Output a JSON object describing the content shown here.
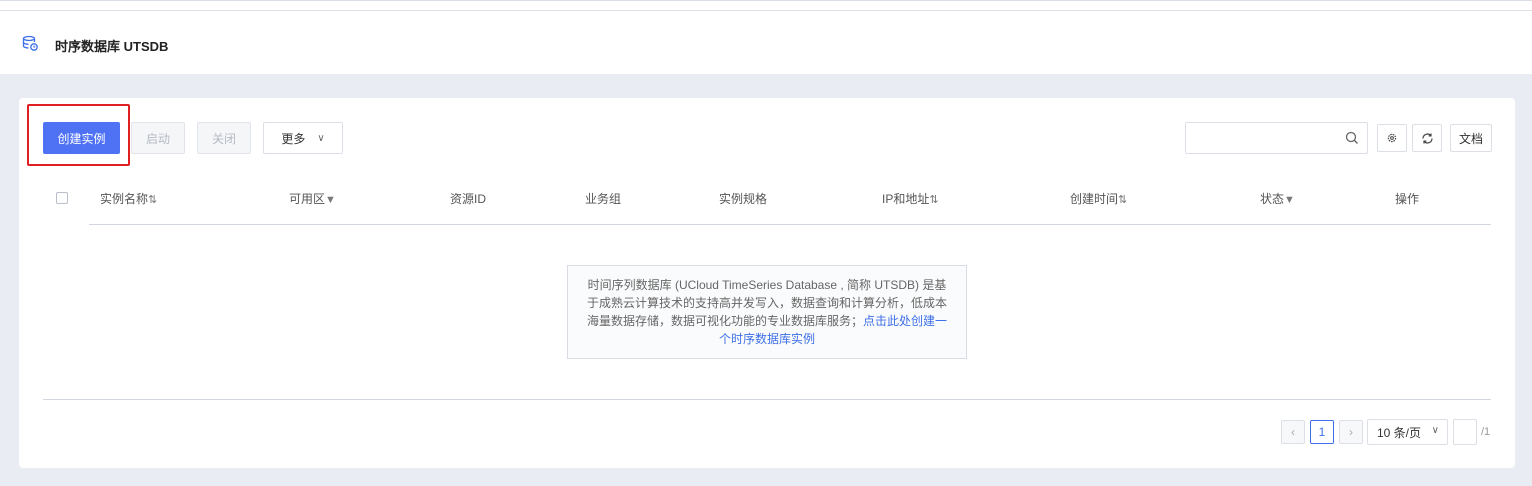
{
  "header": {
    "title": "时序数据库 UTSDB",
    "icon": "database-clock-icon"
  },
  "toolbar": {
    "create_label": "创建实例",
    "start_label": "启动",
    "close_label": "关闭",
    "more_label": "更多",
    "search_placeholder": "",
    "docs_label": "文档"
  },
  "table": {
    "columns": [
      {
        "label": "实例名称",
        "sort": "⇅"
      },
      {
        "label": "可用区",
        "sort": "▼"
      },
      {
        "label": "资源ID",
        "sort": ""
      },
      {
        "label": "业务组",
        "sort": ""
      },
      {
        "label": "实例规格",
        "sort": ""
      },
      {
        "label": "IP和地址",
        "sort": "⇅"
      },
      {
        "label": "创建时间",
        "sort": "⇅"
      },
      {
        "label": "状态",
        "sort": "▼"
      },
      {
        "label": "操作",
        "sort": ""
      }
    ],
    "rows": []
  },
  "empty": {
    "text": "时间序列数据库 (UCloud TimeSeries Database , 简称 UTSDB) 是基于成熟云计算技术的支持高并发写入，数据查询和计算分析，低成本海量数据存储，数据可视化功能的专业数据库服务；",
    "link": "点击此处创建一个时序数据库实例"
  },
  "pagination": {
    "current_page": "1",
    "page_size": "10 条/页",
    "total": "/1",
    "prev": "‹",
    "next": "›"
  },
  "colors": {
    "primary": "#4f72f4",
    "highlight_border": "#e02020",
    "link": "#3d6fe8"
  }
}
